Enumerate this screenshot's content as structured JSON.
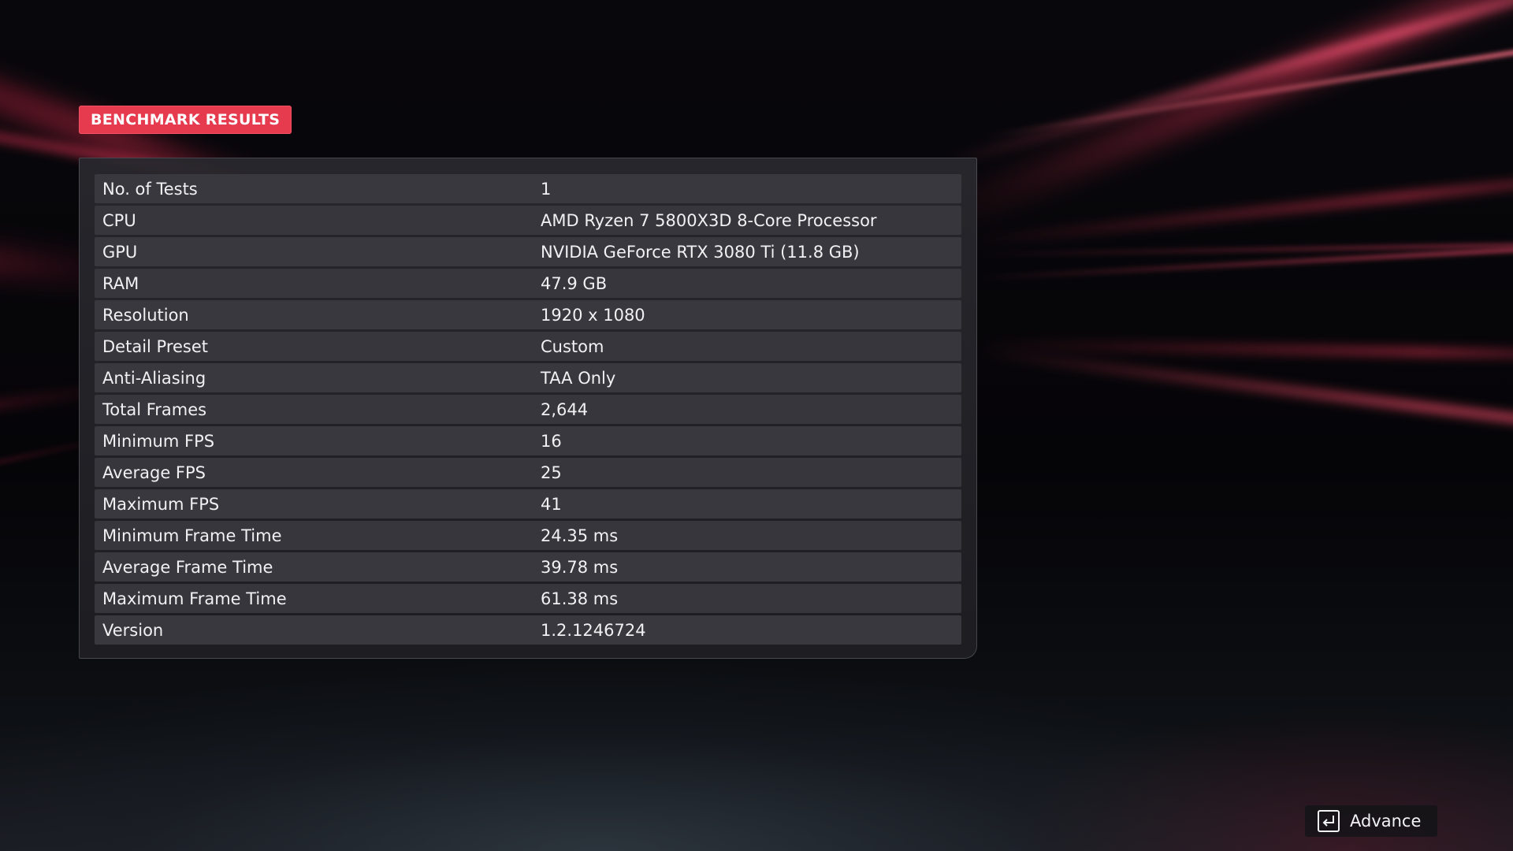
{
  "title": "BENCHMARK RESULTS",
  "results": [
    {
      "label": "No. of Tests",
      "value": "1"
    },
    {
      "label": "CPU",
      "value": "AMD Ryzen 7 5800X3D 8-Core Processor"
    },
    {
      "label": "GPU",
      "value": "NVIDIA GeForce RTX 3080 Ti (11.8 GB)"
    },
    {
      "label": "RAM",
      "value": "47.9 GB"
    },
    {
      "label": "Resolution",
      "value": "1920 x 1080"
    },
    {
      "label": "Detail Preset",
      "value": "Custom"
    },
    {
      "label": "Anti-Aliasing",
      "value": "TAA Only"
    },
    {
      "label": "Total Frames",
      "value": "2,644"
    },
    {
      "label": "Minimum FPS",
      "value": "16"
    },
    {
      "label": "Average FPS",
      "value": "25"
    },
    {
      "label": "Maximum FPS",
      "value": "41"
    },
    {
      "label": "Minimum Frame Time",
      "value": "24.35 ms"
    },
    {
      "label": "Average Frame Time",
      "value": "39.78 ms"
    },
    {
      "label": "Maximum Frame Time",
      "value": "61.38 ms"
    },
    {
      "label": "Version",
      "value": "1.2.1246724"
    }
  ],
  "advance_button": {
    "label": "Advance",
    "icon": "enter-key-icon"
  },
  "colors": {
    "accent": "#e63a4f",
    "panel": "#28282e",
    "row": "#36363c",
    "text": "#f1f1f3"
  }
}
